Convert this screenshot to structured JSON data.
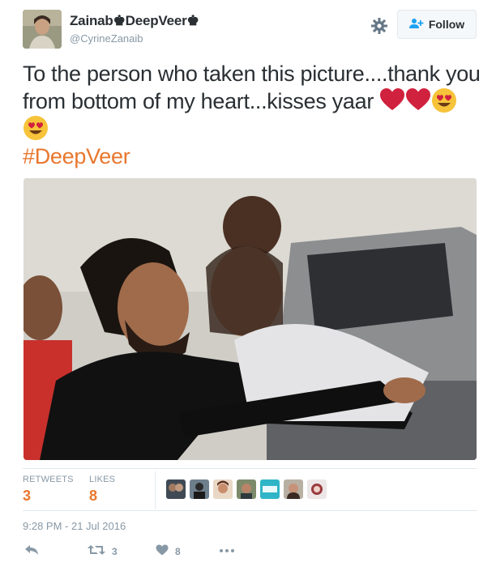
{
  "author": {
    "display_name": "Zainab♚DeepVeer♚",
    "handle": "@CyrineZanaib"
  },
  "follow_button": {
    "label": "Follow"
  },
  "tweet": {
    "text_line1": "To the person who taken this picture....thank you",
    "text_line2": "from bottom of my heart...kisses yaar",
    "hashtag": "#DeepVeer"
  },
  "stats": {
    "retweets_label": "RETWEETS",
    "retweets_value": "3",
    "likes_label": "LIKES",
    "likes_value": "8"
  },
  "timestamp": "9:28 PM - 21 Jul 2016",
  "actions": {
    "retweet_count": "3",
    "like_count": "8"
  },
  "colors": {
    "accent": "#e8772e",
    "muted": "#8899a6",
    "text": "#292f33",
    "heart": "#d0213e"
  },
  "icons": [
    "gear-icon",
    "follow-person-icon",
    "reply-icon",
    "retweet-icon",
    "like-icon",
    "more-icon"
  ]
}
